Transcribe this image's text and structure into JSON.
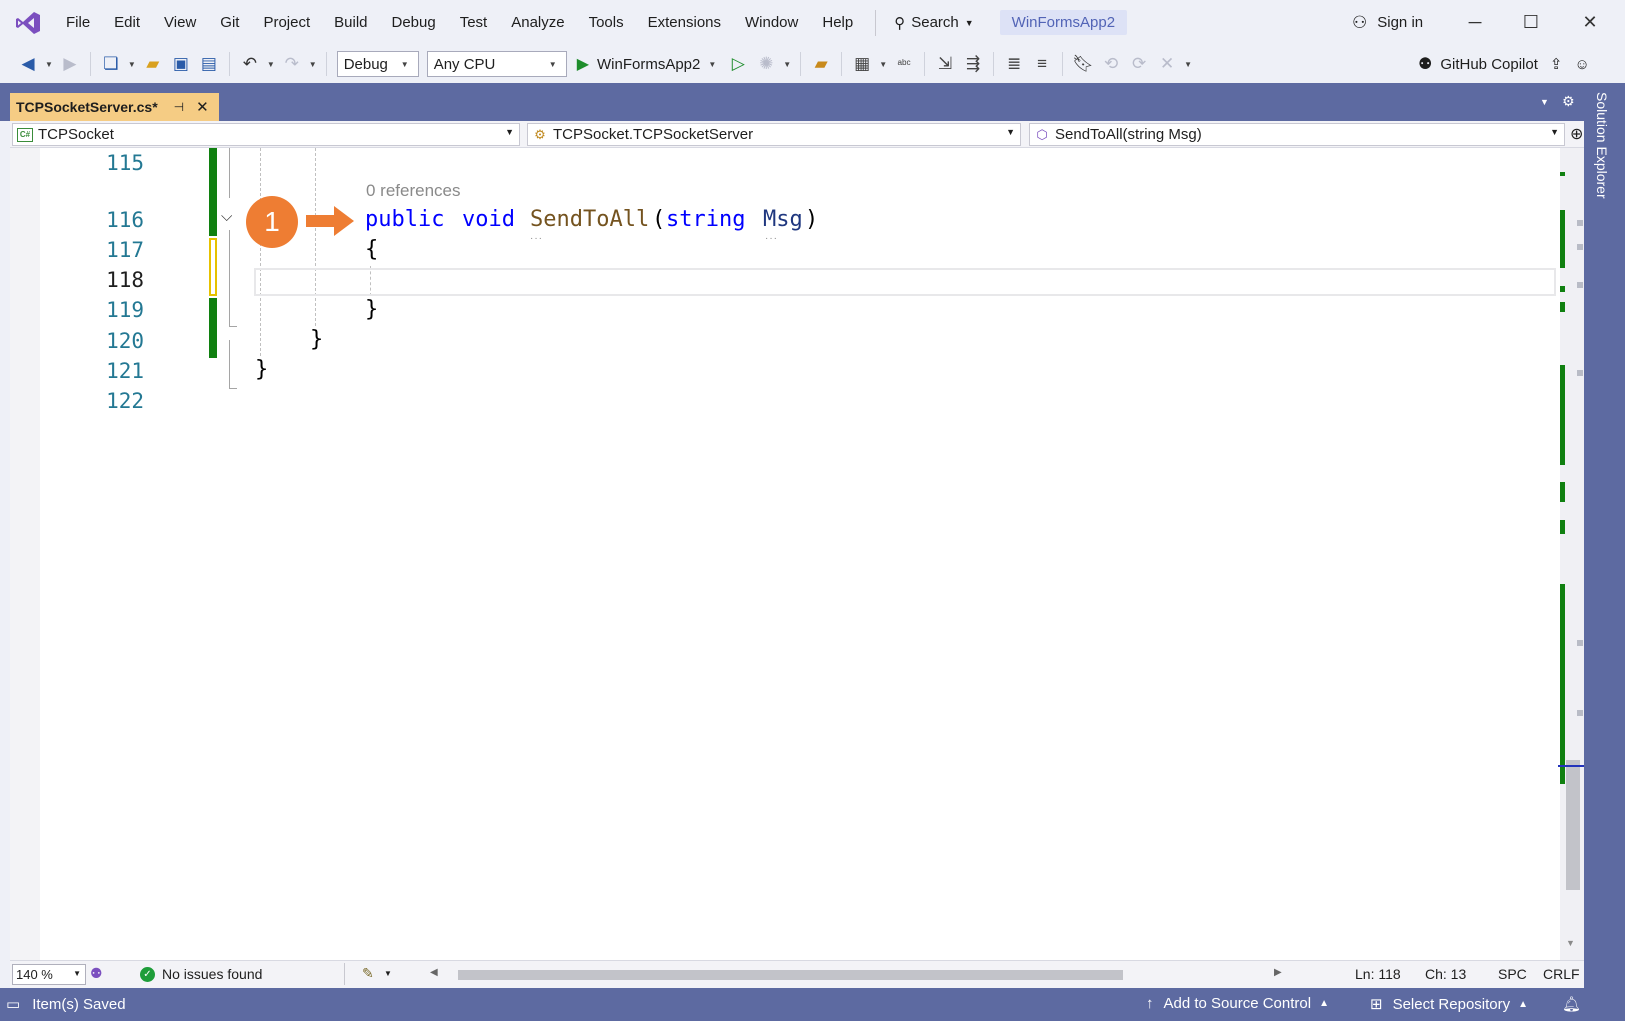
{
  "menu": {
    "items": [
      "File",
      "Edit",
      "View",
      "Git",
      "Project",
      "Build",
      "Debug",
      "Test",
      "Analyze",
      "Tools",
      "Extensions",
      "Window",
      "Help"
    ],
    "search_label": "Search",
    "solution_name": "WinFormsApp2",
    "sign_in": "Sign in"
  },
  "toolbar": {
    "configuration": "Debug",
    "platform": "Any CPU",
    "run_target": "WinFormsApp2",
    "copilot_label": "GitHub Copilot"
  },
  "doc_tab": {
    "title": "TCPSocketServer.cs*"
  },
  "side_panel": {
    "label": "Solution Explorer"
  },
  "navbar": {
    "project": "TCPSocket",
    "type": "TCPSocket.TCPSocketServer",
    "member": "SendToAll(string Msg)"
  },
  "editor": {
    "line_numbers": [
      "115",
      "116",
      "117",
      "118",
      "119",
      "120",
      "121",
      "122"
    ],
    "current_line": "118",
    "codelens": "0 references",
    "code": {
      "kw_public": "public",
      "kw_void": "void",
      "method_name": "SendToAll",
      "paren_open": "(",
      "kw_string": "string",
      "param_name": "Msg",
      "paren_close": ")",
      "brace_open": "{",
      "brace_close": "}"
    },
    "callout_number": "1"
  },
  "colors": {
    "callout": "#ee7d33",
    "keyword": "#0000ff",
    "method": "#74531f",
    "change_bar": "#108010",
    "doc_tab": "#f5cc84",
    "status_bar": "#5d6aa1"
  },
  "edit_status": {
    "zoom": "140 %",
    "issues": "No issues found",
    "ln": "Ln: 118",
    "ch": "Ch: 13",
    "spacing": "SPC",
    "line_ending": "CRLF"
  },
  "statusbar": {
    "message": "Item(s) Saved",
    "source_control": "Add to Source Control",
    "repository": "Select Repository"
  }
}
